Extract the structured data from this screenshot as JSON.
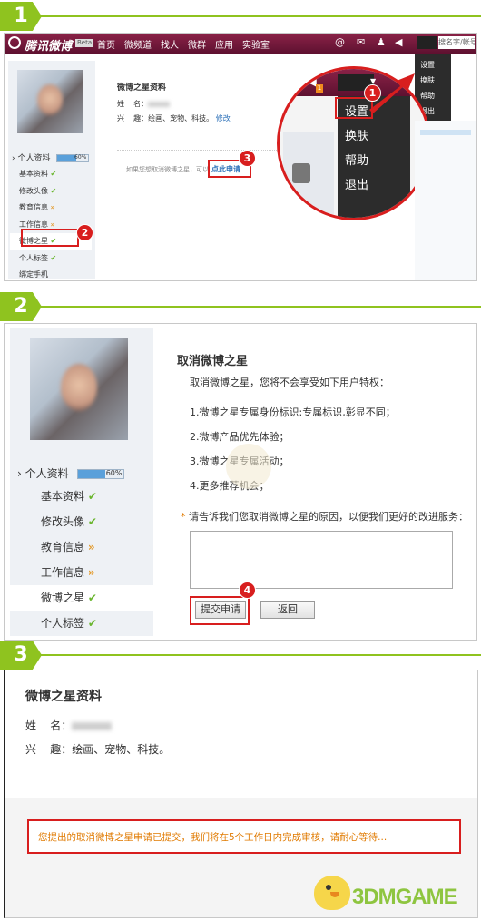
{
  "steps": [
    "1",
    "2",
    "3"
  ],
  "topbar": {
    "brand": "腾讯微博",
    "beta": "Beta",
    "nav": [
      "首页",
      "微频道",
      "找人",
      "微群",
      "应用",
      "实验室"
    ],
    "search_placeholder": "搜名字/帐号"
  },
  "account_menu": {
    "items": [
      "设置",
      "换肤",
      "帮助",
      "退出"
    ]
  },
  "sidebar1": {
    "profile_label": "个人资料",
    "progress_text": "60%",
    "progress_value": 0.6,
    "items": [
      {
        "label": "基本资料",
        "mark": "check"
      },
      {
        "label": "修改头像",
        "mark": "check"
      },
      {
        "label": "教育信息",
        "mark": "more"
      },
      {
        "label": "工作信息",
        "mark": "more"
      },
      {
        "label": "微博之星",
        "mark": "check"
      },
      {
        "label": "个人标签",
        "mark": "check"
      },
      {
        "label": "绑定手机",
        "mark": ""
      }
    ]
  },
  "star_info": {
    "title": "微博之星资料",
    "name_label": "姓    名：",
    "interest_label": "兴    趣：",
    "interests": "绘画、宠物、科技。",
    "modify_link": "修改"
  },
  "cancel_prompt": {
    "text": "如果您想取消微博之星，可以",
    "link": "点此申请"
  },
  "cancel_page": {
    "title": "取消微博之星",
    "intro": "取消微博之星，您将不会享受如下用户特权：",
    "privileges": [
      "1.微博之星专属身份标识:专属标识,彰显不同；",
      "2.微博产品优先体验；",
      "3.微博之星专属活动；",
      "4.更多推荐机会；"
    ],
    "required_mark": "*",
    "reason_label": "请告诉我们您取消微博之星的原因，以便我们更好的改进服务：",
    "submit_label": "提交申请",
    "back_label": "返回"
  },
  "sidebar2": {
    "profile_label": "个人资料",
    "progress_text": "60%",
    "items": [
      {
        "label": "基本资料",
        "mark": "check"
      },
      {
        "label": "修改头像",
        "mark": "check"
      },
      {
        "label": "教育信息",
        "mark": "more"
      },
      {
        "label": "工作信息",
        "mark": "more"
      },
      {
        "label": "微博之星",
        "mark": "check"
      },
      {
        "label": "个人标签",
        "mark": "check"
      }
    ]
  },
  "result": {
    "title": "微博之星资料",
    "name_label": "姓    名：",
    "interest_label": "兴    趣：",
    "interests": "绘画、宠物、科技。",
    "notice": "您提出的取消微博之星申请已提交，我们将在5个工作日内完成审核，请耐心等待..."
  },
  "markers": [
    "1",
    "2",
    "3",
    "4"
  ],
  "watermark": "3DMGAME",
  "colors": {
    "step_green": "#8fc31f",
    "highlight_red": "#d81e1e",
    "topbar": "#6d1737",
    "notice_orange": "#e07a00",
    "link_blue": "#2a6fb8"
  }
}
